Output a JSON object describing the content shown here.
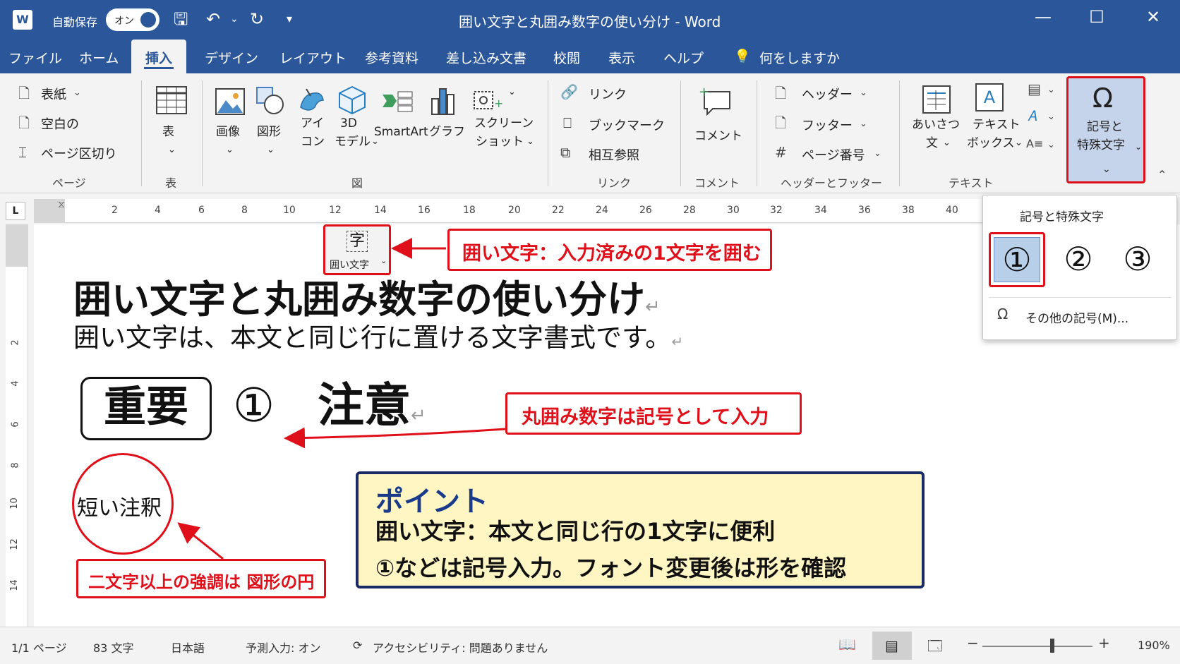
{
  "titlebar": {
    "app_icon": "W",
    "autosave_label": "自動保存",
    "autosave_state": "オン",
    "title": "囲い文字と丸囲み数字の使い分け  -  Word"
  },
  "tabs": [
    "ファイル",
    "ホーム",
    "挿入",
    "デザイン",
    "レイアウト",
    "参考資料",
    "差し込み文書",
    "校閲",
    "表示",
    "ヘルプ"
  ],
  "active_tab": "挿入",
  "search_label": "何をしますか",
  "ribbon": {
    "page": {
      "cover": "表紙",
      "blank": "空白の",
      "break": "ページ区切り",
      "label": "ページ"
    },
    "table": {
      "button": "表",
      "label": "表"
    },
    "illustrations": {
      "image": "画像",
      "shapes": "図形",
      "icons_1": "アイ",
      "icons_2": "コン",
      "model_1": "3D",
      "model_2": "モデル",
      "smartart": "SmartArt",
      "chart": "グラフ",
      "screenshot_1": "スクリーン",
      "screenshot_2": "ショット",
      "label": "図"
    },
    "links": {
      "link": "リンク",
      "bookmark": "ブックマーク",
      "crossref": "相互参照",
      "label": "リンク"
    },
    "comments": {
      "comment": "コメント",
      "label": "コメント"
    },
    "header_footer": {
      "header": "ヘッダー",
      "footer": "フッター",
      "page_number": "ページ番号",
      "label": "ヘッダーとフッター"
    },
    "text": {
      "greeting_1": "あいさつ",
      "greeting_2": "文",
      "textbox_1": "テキスト",
      "textbox_2": "ボックス",
      "textbox_glyph": "A",
      "label": "テキスト"
    },
    "symbols": {
      "label_1": "記号と",
      "label_2": "特殊文字"
    }
  },
  "ruler": {
    "corner": "L",
    "ticks": [
      "2",
      "4",
      "6",
      "8",
      "10",
      "12",
      "14",
      "16",
      "18",
      "20",
      "22",
      "24",
      "26",
      "28",
      "30",
      "32",
      "34",
      "36",
      "38",
      "40"
    ],
    "vticks": [
      "2",
      "4",
      "6",
      "8",
      "10",
      "12",
      "14"
    ]
  },
  "dropdown": {
    "title": "記号と特殊文字",
    "symbols": [
      "①",
      "②",
      "③"
    ],
    "more": "その他の記号(M)..."
  },
  "doc": {
    "enclose_button": {
      "glyph": "字",
      "label": "囲い文字"
    },
    "callout_enclose": "囲い文字：入力済みの1文字を囲む",
    "heading": "囲い文字と丸囲み数字の使い分け",
    "para": "囲い文字は、本文と同じ行に置ける文字書式です。",
    "boxed_word": "重要",
    "circled_one": "①",
    "caution": "注意",
    "callout_circled": "丸囲み数字は記号として入力",
    "circle_note": "短い注釈",
    "callout_shape": "二文字以上の強調は 図形の円",
    "point_title": "ポイント",
    "point_line1": "囲い文字：本文と同じ行の1文字に便利",
    "point_line2": "①などは記号入力。フォント変更後は形を確認",
    "para_mark": "↵"
  },
  "status": {
    "page": "1/1 ページ",
    "words": "83 文字",
    "language": "日本語",
    "prediction": "予測入力: オン",
    "accessibility": "アクセシビリティ:  問題ありません",
    "zoom": "190%"
  },
  "colors": {
    "word_blue": "#2b579a",
    "callout_red": "#e0101b",
    "point_bg": "#fff6c4",
    "point_border": "#1a2a66"
  }
}
